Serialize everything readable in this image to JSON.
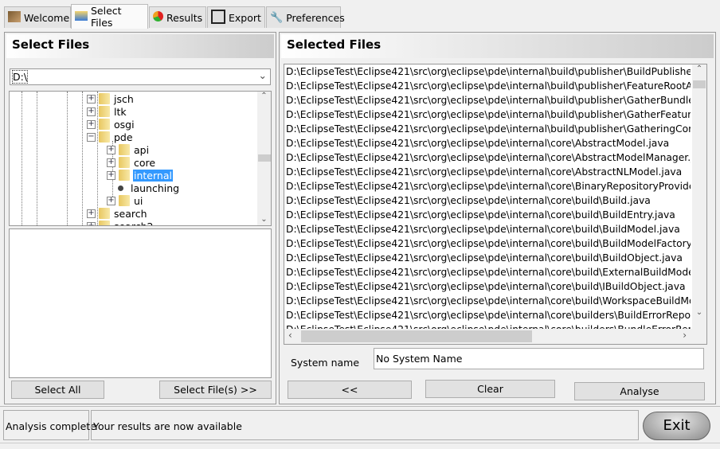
{
  "tabs": [
    {
      "label": "Welcome",
      "icon": "eagle-icon"
    },
    {
      "label": "Select Files",
      "icon": "folder-open-icon"
    },
    {
      "label": "Results",
      "icon": "pie-chart-icon"
    },
    {
      "label": "Export",
      "icon": "floppy-disk-icon"
    },
    {
      "label": "Preferences",
      "icon": "wrench-icon"
    }
  ],
  "active_tab": "Select Files",
  "left": {
    "title": "Select Files",
    "drive": "D:\\",
    "tree": [
      {
        "label": "jsch",
        "level": 0,
        "exp": "+"
      },
      {
        "label": "ltk",
        "level": 0,
        "exp": "+"
      },
      {
        "label": "osgi",
        "level": 0,
        "exp": "+"
      },
      {
        "label": "pde",
        "level": 0,
        "exp": "-"
      },
      {
        "label": "api",
        "level": 1,
        "exp": "+"
      },
      {
        "label": "core",
        "level": 1,
        "exp": "+"
      },
      {
        "label": "internal",
        "level": 1,
        "exp": "+",
        "selected": true
      },
      {
        "label": "launching",
        "level": 1,
        "exp": "leaf"
      },
      {
        "label": "ui",
        "level": 1,
        "exp": "+"
      },
      {
        "label": "search",
        "level": 0,
        "exp": "+"
      },
      {
        "label": "search2",
        "level": 0,
        "exp": "+"
      }
    ],
    "select_all": "Select All",
    "select_files": "Select File(s) >>"
  },
  "right": {
    "title": "Selected Files",
    "files": [
      "D:\\EclipseTest\\Eclipse421\\src\\org\\eclipse\\pde\\internal\\build\\publisher\\BuildPublisherApplication.java",
      "D:\\EclipseTest\\Eclipse421\\src\\org\\eclipse\\pde\\internal\\build\\publisher\\FeatureRootAdvice.java",
      "D:\\EclipseTest\\Eclipse421\\src\\org\\eclipse\\pde\\internal\\build\\publisher\\GatherBundleAction.java",
      "D:\\EclipseTest\\Eclipse421\\src\\org\\eclipse\\pde\\internal\\build\\publisher\\GatherFeatureAction.java",
      "D:\\EclipseTest\\Eclipse421\\src\\org\\eclipse\\pde\\internal\\build\\publisher\\GatheringComputer.java",
      "D:\\EclipseTest\\Eclipse421\\src\\org\\eclipse\\pde\\internal\\core\\AbstractModel.java",
      "D:\\EclipseTest\\Eclipse421\\src\\org\\eclipse\\pde\\internal\\core\\AbstractModelManager.java",
      "D:\\EclipseTest\\Eclipse421\\src\\org\\eclipse\\pde\\internal\\core\\AbstractNLModel.java",
      "D:\\EclipseTest\\Eclipse421\\src\\org\\eclipse\\pde\\internal\\core\\BinaryRepositoryProvider.java",
      "D:\\EclipseTest\\Eclipse421\\src\\org\\eclipse\\pde\\internal\\core\\build\\Build.java",
      "D:\\EclipseTest\\Eclipse421\\src\\org\\eclipse\\pde\\internal\\core\\build\\BuildEntry.java",
      "D:\\EclipseTest\\Eclipse421\\src\\org\\eclipse\\pde\\internal\\core\\build\\BuildModel.java",
      "D:\\EclipseTest\\Eclipse421\\src\\org\\eclipse\\pde\\internal\\core\\build\\BuildModelFactory.java",
      "D:\\EclipseTest\\Eclipse421\\src\\org\\eclipse\\pde\\internal\\core\\build\\BuildObject.java",
      "D:\\EclipseTest\\Eclipse421\\src\\org\\eclipse\\pde\\internal\\core\\build\\ExternalBuildModel.java",
      "D:\\EclipseTest\\Eclipse421\\src\\org\\eclipse\\pde\\internal\\core\\build\\IBuildObject.java",
      "D:\\EclipseTest\\Eclipse421\\src\\org\\eclipse\\pde\\internal\\core\\build\\WorkspaceBuildModel.java",
      "D:\\EclipseTest\\Eclipse421\\src\\org\\eclipse\\pde\\internal\\core\\builders\\BuildErrorReporter.java",
      "D:\\EclipseTest\\Eclipse421\\src\\org\\eclipse\\pde\\internal\\core\\builders\\BundleErrorReporter.java"
    ],
    "system_name_label": "System name",
    "system_name_value": "No System Name",
    "back": "<<",
    "clear": "Clear",
    "analyse": "Analyse"
  },
  "status": {
    "left": "Analysis complete",
    "message": "Your results are now available",
    "exit": "Exit"
  },
  "colors": {
    "selection": "#3399ff"
  }
}
